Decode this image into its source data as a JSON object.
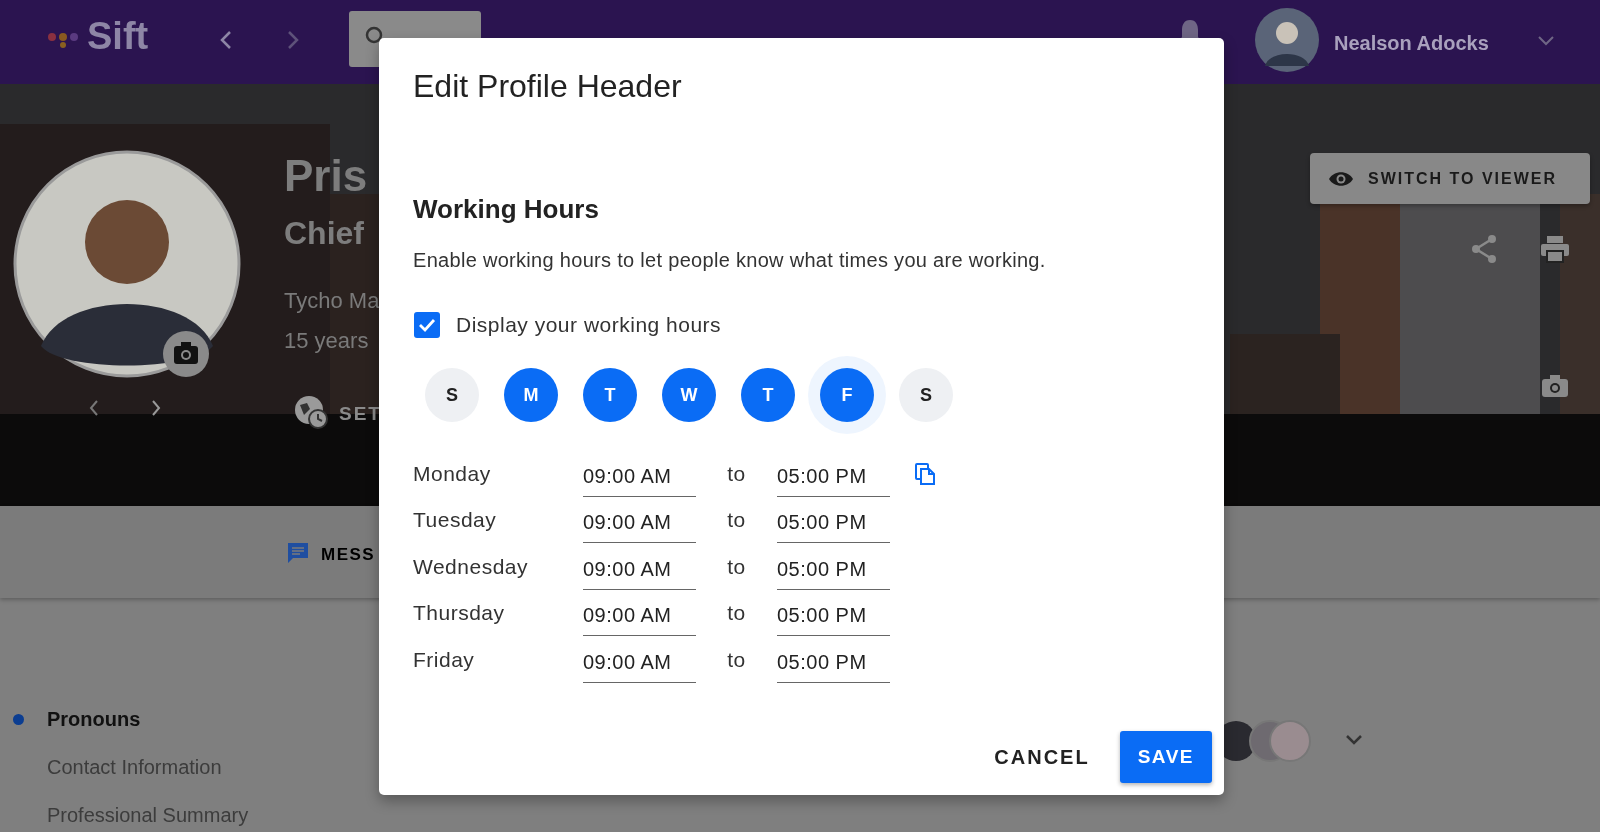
{
  "top_bar": {
    "logo": "Sift",
    "user": {
      "name": "Nealson Adocks"
    }
  },
  "profile": {
    "name": "Pris",
    "title": "Chief",
    "company": "Tycho Ma",
    "tenure": "15 years",
    "timezone_button": "SET",
    "message_button": "MESS",
    "switch_button": "SWITCH TO VIEWER"
  },
  "sections": [
    {
      "label": "Pronouns",
      "selected": true
    },
    {
      "label": "Contact Information",
      "selected": false
    },
    {
      "label": "Professional Summary",
      "selected": false
    }
  ],
  "dialog": {
    "title": "Edit Profile Header",
    "section_title": "Working Hours",
    "description": "Enable working hours to let people know what times you are working.",
    "display_checkbox": {
      "label": "Display your working hours",
      "checked": true
    },
    "days": [
      {
        "label": "S",
        "selected": false,
        "focused": false
      },
      {
        "label": "M",
        "selected": true,
        "focused": false
      },
      {
        "label": "T",
        "selected": true,
        "focused": false
      },
      {
        "label": "W",
        "selected": true,
        "focused": false
      },
      {
        "label": "T",
        "selected": true,
        "focused": false
      },
      {
        "label": "F",
        "selected": true,
        "focused": true
      },
      {
        "label": "S",
        "selected": false,
        "focused": false
      }
    ],
    "schedule": [
      {
        "day": "Monday",
        "start": "09:00 AM",
        "separator": "to",
        "end": "05:00 PM",
        "copy_button": true
      },
      {
        "day": "Tuesday",
        "start": "09:00 AM",
        "separator": "to",
        "end": "05:00 PM",
        "copy_button": false
      },
      {
        "day": "Wednesday",
        "start": "09:00 AM",
        "separator": "to",
        "end": "05:00 PM",
        "copy_button": false
      },
      {
        "day": "Thursday",
        "start": "09:00 AM",
        "separator": "to",
        "end": "05:00 PM",
        "copy_button": false
      },
      {
        "day": "Friday",
        "start": "09:00 AM",
        "separator": "to",
        "end": "05:00 PM",
        "copy_button": false
      }
    ],
    "buttons": [
      {
        "label": "CANCEL",
        "kind": "text"
      },
      {
        "label": "SAVE",
        "kind": "primary"
      }
    ]
  }
}
